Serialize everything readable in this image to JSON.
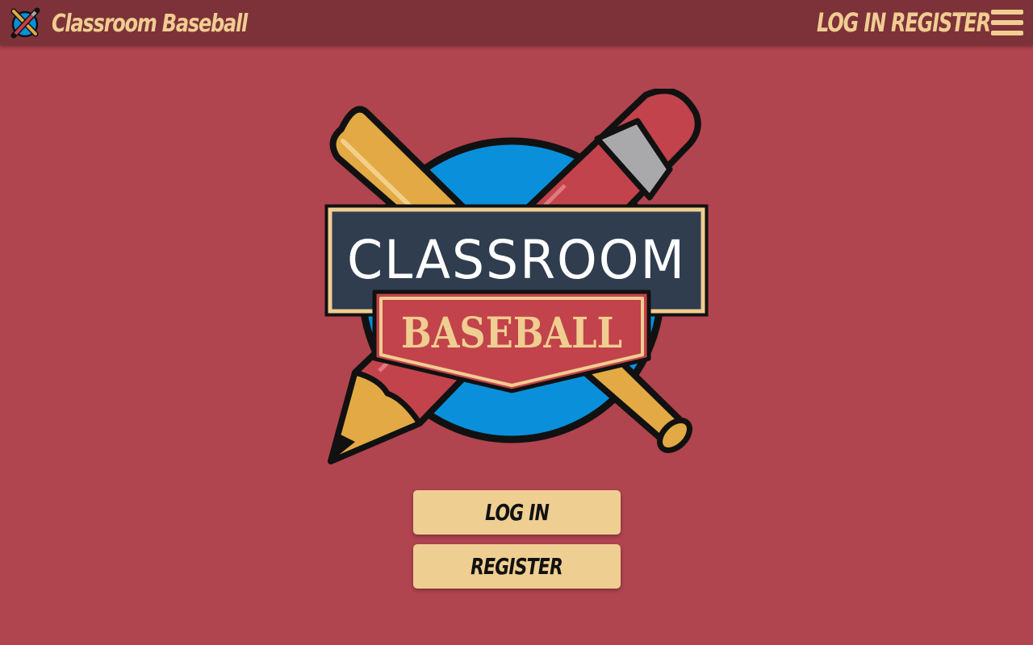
{
  "header": {
    "app_title": "Classroom Baseball",
    "nav": {
      "login_label": "LOG IN",
      "register_label": "REGISTER"
    },
    "menu_icon": "hamburger-menu-icon"
  },
  "logo": {
    "top_text": "CLASSROOM",
    "bottom_text": "BASEBALL"
  },
  "main": {
    "login_button_label": "LOG IN",
    "register_button_label": "REGISTER"
  },
  "colors": {
    "page_background": "#b0444f",
    "header_background": "#7d3239",
    "accent_cream": "#f0cd91",
    "logo_blue": "#0a8fdb",
    "chalkboard": "#2f3d4f"
  }
}
